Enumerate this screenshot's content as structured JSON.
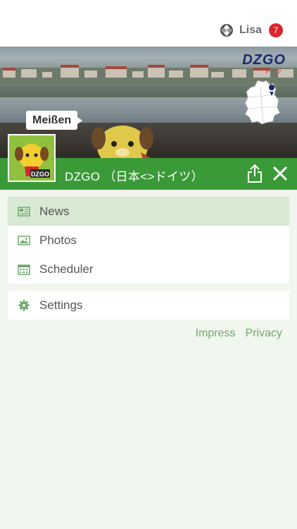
{
  "user": {
    "name": "Lisa",
    "notification_count": "7"
  },
  "banner": {
    "place_label": "Meißen",
    "logo_text": "DZGO",
    "logo_sub": "ドイツ"
  },
  "header": {
    "title": "DZGO （日本<>ドイツ）"
  },
  "menu": {
    "main_items": [
      {
        "label": "News",
        "icon": "newspaper-icon",
        "active": true
      },
      {
        "label": "Photos",
        "icon": "image-icon",
        "active": false
      },
      {
        "label": "Scheduler",
        "icon": "calendar-icon",
        "active": false
      }
    ],
    "settings": {
      "label": "Settings",
      "icon": "gear-icon"
    }
  },
  "footer_links": {
    "impress": "Impress",
    "privacy": "Privacy"
  },
  "colors": {
    "accent": "#3a9a38",
    "active_bg": "#d7e8d3",
    "badge": "#d8262e",
    "link": "#6fa96a",
    "background": "#f1f6ee"
  }
}
